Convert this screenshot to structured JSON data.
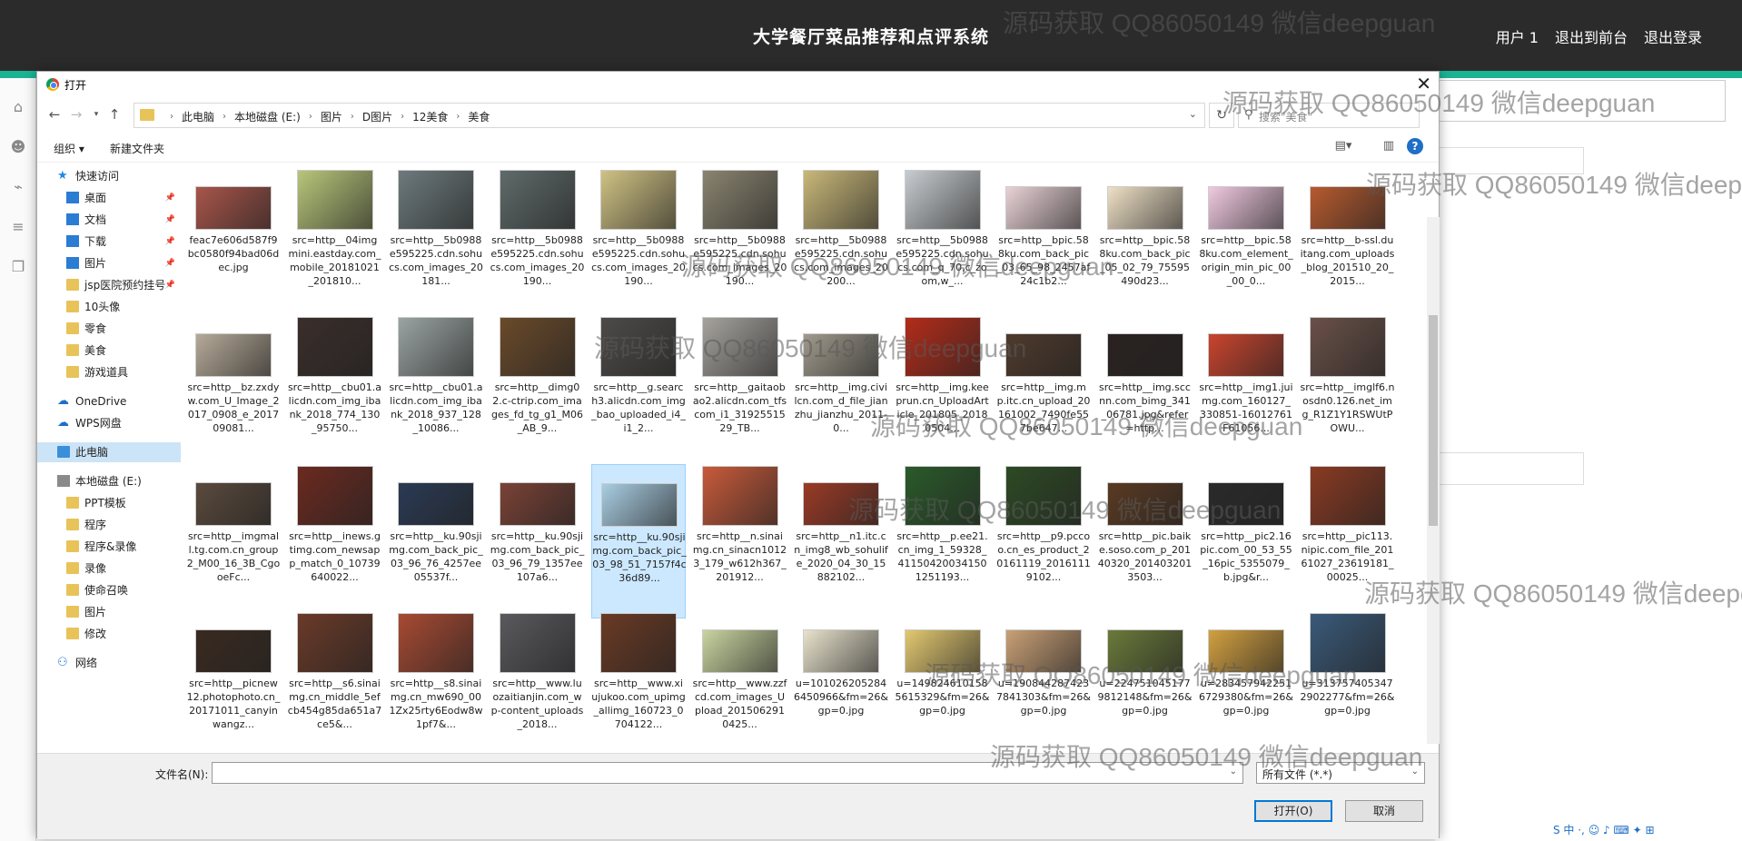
{
  "app": {
    "title": "大学餐厅菜品推荐和点评系统",
    "nav": [
      "用户 1",
      "退出到前台",
      "退出登录"
    ]
  },
  "watermark": "源码获取 QQ86050149 微信deepguan",
  "dialog": {
    "title": "打开",
    "breadcrumbs": [
      "此电脑",
      "本地磁盘 (E:)",
      "图片",
      "D图片",
      "12美食",
      "美食"
    ],
    "search_placeholder": "搜索\"美食\"",
    "toolbar": {
      "organize": "组织 ▾",
      "new_folder": "新建文件夹"
    },
    "nav_pane": [
      {
        "label": "快速访问",
        "icon": "star-icon"
      },
      {
        "label": "桌面",
        "icon": "desktop-icon"
      },
      {
        "label": "文档",
        "icon": "documents-icon"
      },
      {
        "label": "下载",
        "icon": "download-icon"
      },
      {
        "label": "图片",
        "icon": "pictures-icon"
      },
      {
        "label": "jsp医院预约挂号",
        "icon": "folder-icon"
      },
      {
        "label": "10头像",
        "icon": "folder-icon"
      },
      {
        "label": "零食",
        "icon": "folder-icon"
      },
      {
        "label": "美食",
        "icon": "folder-icon"
      },
      {
        "label": "游戏道具",
        "icon": "folder-icon"
      },
      {
        "label": "OneDrive",
        "icon": "cloud-icon"
      },
      {
        "label": "WPS网盘",
        "icon": "cloud-icon"
      },
      {
        "label": "此电脑",
        "icon": "computer-icon"
      },
      {
        "label": "本地磁盘 (E:)",
        "icon": "drive-icon"
      },
      {
        "label": "PPT模板",
        "icon": "folder-icon"
      },
      {
        "label": "程序",
        "icon": "folder-icon"
      },
      {
        "label": "程序&录像",
        "icon": "folder-icon"
      },
      {
        "label": "录像",
        "icon": "folder-icon"
      },
      {
        "label": "使命召唤",
        "icon": "folder-icon"
      },
      {
        "label": "图片",
        "icon": "folder-icon"
      },
      {
        "label": "修改",
        "icon": "folder-icon"
      },
      {
        "label": "网络",
        "icon": "network-icon"
      }
    ],
    "files": [
      {
        "name": "feac7e606d587f9bc0580f94bad06dec.jpg",
        "color": "#a8554a"
      },
      {
        "name": "src=http__04imgmini.eastday.com_mobile_20181021_201810...",
        "color": "#b8c67a"
      },
      {
        "name": "src=http__5b0988e595225.cdn.sohucs.com_images_20181...",
        "color": "#6d7a7c"
      },
      {
        "name": "src=http__5b0988e595225.cdn.sohucs.com_images_20190...",
        "color": "#5f6b6a"
      },
      {
        "name": "src=http__5b0988e595225.cdn.sohucs.com_images_20190...",
        "color": "#d0c283"
      },
      {
        "name": "src=http__5b0988e595225.cdn.sohucs.com_images_20190...",
        "color": "#8a8470"
      },
      {
        "name": "src=http__5b0988e595225.cdn.sohucs.com_images_20200...",
        "color": "#c9b879"
      },
      {
        "name": "src=http__5b0988e595225.cdn.sohucs.com_q_70,c_zoom,w_...",
        "color": "#c7ccd0"
      },
      {
        "name": "src=http__bpic.588ku.com_back_pic_03_65_98_2457af24c1b2...",
        "color": "#e9d2d6"
      },
      {
        "name": "src=http__bpic.588ku.com_back_pic_05_02_79_75595490d23...",
        "color": "#efe0c6"
      },
      {
        "name": "src=http__bpic.588ku.com_element_origin_min_pic_00_00_0...",
        "color": "#f0c9e0"
      },
      {
        "name": "src=http__b-ssl.duitang.com_uploads_blog_201510_20_2015...",
        "color": "#b75a2e"
      },
      {
        "name": "src=http__bz.zxdyw.com_U_Image_2017_0908_e_201709081...",
        "color": "#b6aa99"
      },
      {
        "name": "src=http__cbu01.alicdn.com_img_ibank_2018_774_130_95750...",
        "color": "#3a2e2a"
      },
      {
        "name": "src=http__cbu01.alicdn.com_img_ibank_2018_937_128_10086...",
        "color": "#9aa4a2"
      },
      {
        "name": "src=http__dimg02.c-ctrip.com_images_fd_tg_g1_M06_AB_9...",
        "color": "#6a4a2a"
      },
      {
        "name": "src=http__g.search3.alicdn.com_img_bao_uploaded_i4_i1_2...",
        "color": "#4d4b48"
      },
      {
        "name": "src=http__gaitaobao2.alicdn.com_tfscom_i1_3192551529_TB...",
        "color": "#a6a39e"
      },
      {
        "name": "src=http__img.civilcn.com_d_file_jianzhu_jianzhu_2011-0...",
        "color": "#a09a8c"
      },
      {
        "name": "src=http__img.keeprun.cn_UploadArticle_201805_20180504...",
        "color": "#b32c1a"
      },
      {
        "name": "src=http__img.mp.itc.cn_upload_20161002_7490fe557be647...",
        "color": "#4f3a2c"
      },
      {
        "name": "src=http__img.sccnn.com_bimg_341_06781.jpg&refer=http...",
        "color": "#2a2220"
      },
      {
        "name": "src=http__img1.juimg.com_160127_330851-16012761F61056...",
        "color": "#c9442e"
      },
      {
        "name": "src=http__imglf6.nosdn0.126.net_img_R1Z1Y1RSWUtPOWU...",
        "color": "#6a5048"
      },
      {
        "name": "src=http__imgmall.tg.com.cn_group2_M00_16_3B_CgooeFc...",
        "color": "#5a4a3c"
      },
      {
        "name": "src=http__inews.gtimg.com_newsapp_match_0_10739640022...",
        "color": "#6b2a20"
      },
      {
        "name": "src=http__ku.90sjimg.com_back_pic_03_96_76_4257ee05537f...",
        "color": "#2a3a54"
      },
      {
        "name": "src=http__ku.90sjimg.com_back_pic_03_96_79_1357ee107a6...",
        "color": "#7a4236"
      },
      {
        "name": "src=http__ku.90sjimg.com_back_pic_03_98_51_7157f4c36d89...",
        "color": "#a9cde2"
      },
      {
        "name": "src=http__n.sinaimg.cn_sinacn10123_179_w612h367_201912...",
        "color": "#c85a3a"
      },
      {
        "name": "src=http__n1.itc.cn_img8_wb_sohulife_2020_04_30_15882102...",
        "color": "#9a3a26"
      },
      {
        "name": "src=http__p.ee21.cn_img_1_59328_411504200341501251193...",
        "color": "#2a5a2a"
      },
      {
        "name": "src=http__p9.pccoo.cn_es_product_20161119_20161119102...",
        "color": "#2d4a24"
      },
      {
        "name": "src=http__pic.baike.soso.com_p_20140320_2014032013503...",
        "color": "#5a3a22"
      },
      {
        "name": "src=http__pic2.16pic.com_00_53_55_16pic_5355079_b.jpg&r...",
        "color": "#2a2a2a"
      },
      {
        "name": "src=http__pic113.nipic.com_file_20161027_23619181_00025...",
        "color": "#8a3a22"
      },
      {
        "name": "src=http__picnew12.photophoto.cn_20171011_canyinwangz...",
        "color": "#3a2a20"
      },
      {
        "name": "src=http__s6.sinaimg.cn_middle_5efcb454g85da651a7ce5&...",
        "color": "#6a3a28"
      },
      {
        "name": "src=http__s8.sinaimg.cn_mw690_001Zx25rty6Eodw8w1pf7&...",
        "color": "#a84a32"
      },
      {
        "name": "src=http__www.luozaitianjin.com_wp-content_uploads_2018...",
        "color": "#5a5a5e"
      },
      {
        "name": "src=http__www.xiujukoo.com_upimg_allimg_160723_0704122...",
        "color": "#6a3a24"
      },
      {
        "name": "src=http__www.zzfcd.com_images_Upload_2015062910425...",
        "color": "#c9d4a0"
      },
      {
        "name": "u=1010262052846450966&fm=26&gp=0.jpg",
        "color": "#e8e2cc"
      },
      {
        "name": "u=1498246101585615329&fm=26&gp=0.jpg",
        "color": "#e2c870"
      },
      {
        "name": "u=1908442874237841303&fm=26&gp=0.jpg",
        "color": "#c9a076"
      },
      {
        "name": "u=2247510451779812148&fm=26&gp=0.jpg",
        "color": "#6a7a3a"
      },
      {
        "name": "u=2834579422516729380&fm=26&gp=0.jpg",
        "color": "#d2a040"
      },
      {
        "name": "u=3137574053472902277&fm=26&gp=0.jpg",
        "color": "#3a5a7a"
      }
    ],
    "file_name_label": "文件名(N):",
    "file_name_value": "",
    "filter": "所有文件 (*.*)",
    "open_button": "打开(O)",
    "cancel_button": "取消"
  }
}
